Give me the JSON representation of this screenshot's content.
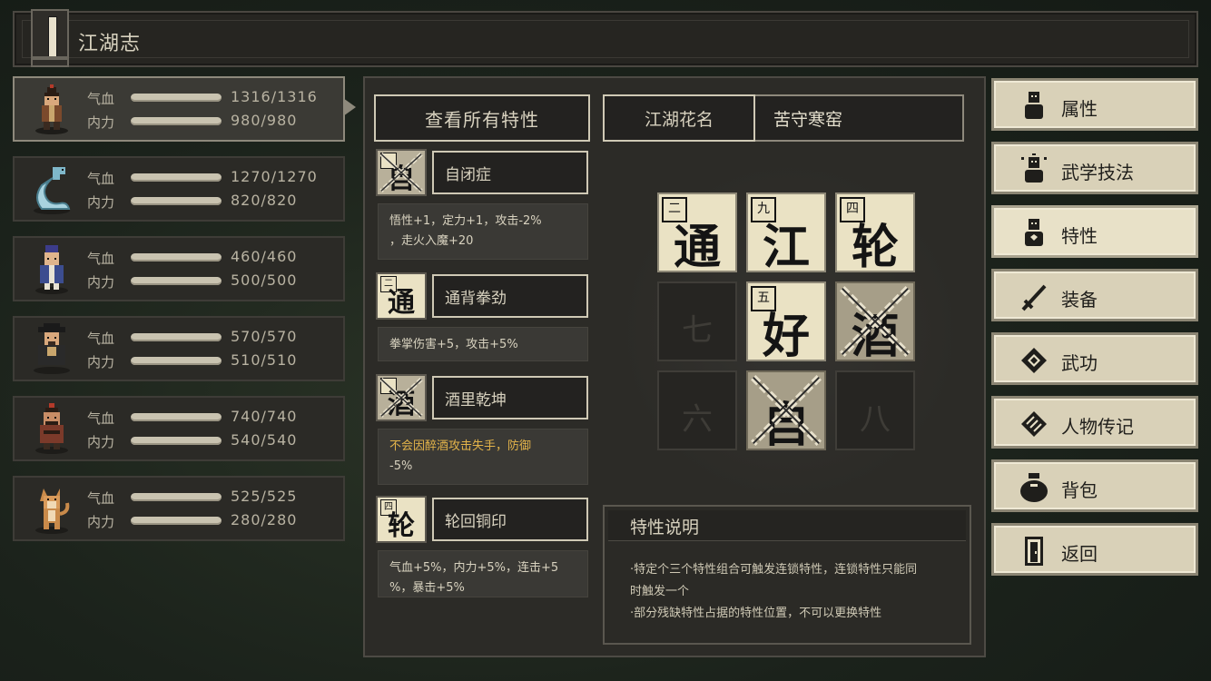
{
  "header": {
    "title": "江湖志"
  },
  "characters": [
    {
      "hp_label": "气血",
      "mp_label": "内力",
      "hp": "1316/1316",
      "mp": "980/980",
      "avatar": "warrior-avatar"
    },
    {
      "hp_label": "气血",
      "mp_label": "内力",
      "hp": "1270/1270",
      "mp": "820/820",
      "avatar": "snake-avatar"
    },
    {
      "hp_label": "气血",
      "mp_label": "内力",
      "hp": "460/460",
      "mp": "500/500",
      "avatar": "scholar-avatar"
    },
    {
      "hp_label": "气血",
      "mp_label": "内力",
      "hp": "570/570",
      "mp": "510/510",
      "avatar": "official-avatar"
    },
    {
      "hp_label": "气血",
      "mp_label": "内力",
      "hp": "740/740",
      "mp": "540/540",
      "avatar": "bandit-avatar"
    },
    {
      "hp_label": "气血",
      "mp_label": "内力",
      "hp": "525/525",
      "mp": "280/280",
      "avatar": "dog-avatar"
    }
  ],
  "main": {
    "view_all_label": "查看所有特性",
    "nickname_label": "江湖花名",
    "nickname_value": "苦守寒窑",
    "traits": [
      {
        "icon_char": "自",
        "icon_num": "",
        "name": "自闭症",
        "desc_lines": [
          "悟性+1，定力+1，攻击-2%",
          "，走火入魔+20"
        ],
        "broken": true,
        "warn": false
      },
      {
        "icon_char": "通",
        "icon_num": "二",
        "name": "通背拳劲",
        "desc_lines": [
          "拳掌伤害+5，攻击+5%"
        ],
        "broken": false,
        "warn": false
      },
      {
        "icon_char": "酒",
        "icon_num": "",
        "name": "酒里乾坤",
        "desc_lines": [
          "不会因醉酒攻击失手，防御",
          "-5%"
        ],
        "broken": true,
        "warn": true
      },
      {
        "icon_char": "轮",
        "icon_num": "四",
        "name": "轮回铜印",
        "desc_lines": [
          "气血+5%，内力+5%，连击+5",
          "%，暴击+5%"
        ],
        "broken": false,
        "warn": false
      }
    ],
    "grid": [
      {
        "big": "通",
        "num": "二",
        "state": "filled"
      },
      {
        "big": "江",
        "num": "九",
        "state": "filled"
      },
      {
        "big": "轮",
        "num": "四",
        "state": "filled"
      },
      {
        "big": "七",
        "num": "",
        "state": "empty"
      },
      {
        "big": "好",
        "num": "五",
        "state": "filled"
      },
      {
        "big": "酒",
        "num": "",
        "state": "broken"
      },
      {
        "big": "六",
        "num": "",
        "state": "empty"
      },
      {
        "big": "自",
        "num": "",
        "state": "broken"
      },
      {
        "big": "八",
        "num": "",
        "state": "empty"
      }
    ],
    "description": {
      "title": "特性说明",
      "lines": [
        "·特定个三个特性组合可触发连锁特性，连锁特性只能同",
        "时触发一个",
        "·部分残缺特性占据的特性位置，不可以更换特性"
      ]
    }
  },
  "menu": [
    {
      "label": "属性",
      "icon": "person-icon",
      "active": false
    },
    {
      "label": "武学技法",
      "icon": "aura-person-icon",
      "active": false
    },
    {
      "label": "特性",
      "icon": "trait-person-icon",
      "active": true
    },
    {
      "label": "装备",
      "icon": "sword-icon",
      "active": false
    },
    {
      "label": "武功",
      "icon": "scroll-icon",
      "active": false
    },
    {
      "label": "人物传记",
      "icon": "biography-icon",
      "active": false
    },
    {
      "label": "背包",
      "icon": "bag-icon",
      "active": false
    },
    {
      "label": "返回",
      "icon": "door-icon",
      "active": false
    }
  ],
  "colors": {
    "accent_warn": "#e2b34a",
    "tile": "#eae2c4",
    "frame": "#cfc9b5"
  }
}
